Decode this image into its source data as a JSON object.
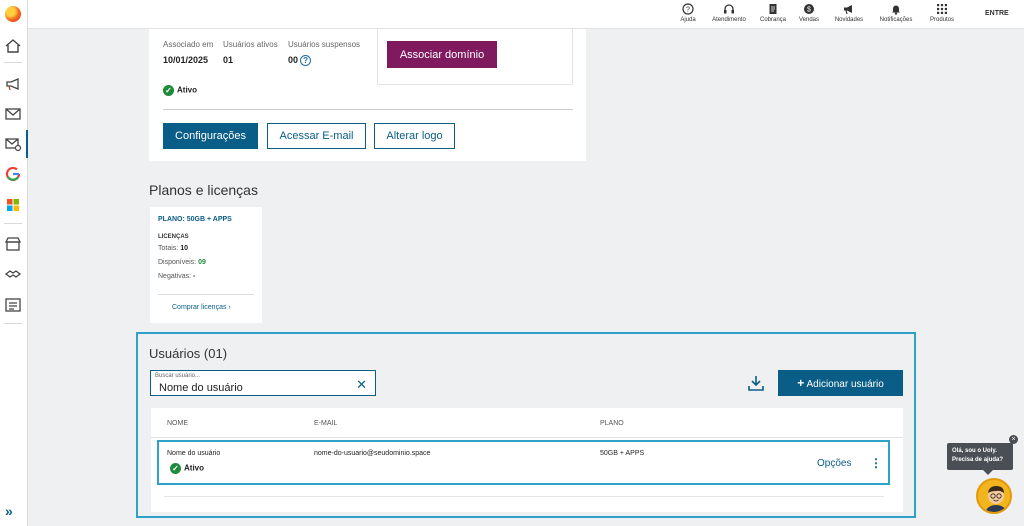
{
  "rail": {
    "icons": [
      "home-icon",
      "megaphone-icon",
      "mail-icon",
      "mail-settings-icon",
      "google-icon",
      "windows-icon",
      "store-icon",
      "handshake-icon",
      "list-icon"
    ],
    "expand": "»"
  },
  "topbar": {
    "items": [
      {
        "icon": "help-icon",
        "label": "Ajuda"
      },
      {
        "icon": "headset-icon",
        "label": "Atendimento"
      },
      {
        "icon": "invoice-icon",
        "label": "Cobrança"
      },
      {
        "icon": "sales-icon",
        "label": "Vendas"
      },
      {
        "icon": "megaphone-icon",
        "label": "Novidades"
      },
      {
        "icon": "bell-icon",
        "label": "Notificações"
      },
      {
        "icon": "grid-icon",
        "label": "Produtos"
      }
    ],
    "login": "ENTRE"
  },
  "domain": {
    "associated_label": "Associado em",
    "associated_value": "10/01/2025",
    "active_users_label": "Usuários ativos",
    "active_users_value": "01",
    "suspended_label": "Usuários suspensos",
    "suspended_value": "00",
    "help": "?",
    "associate_button": "Associar domínio",
    "status": "Ativo",
    "configure_button": "Configurações",
    "access_email_button": "Acessar E-mail",
    "change_logo_button": "Alterar logo"
  },
  "plans": {
    "title": "Planos e licenças",
    "card": {
      "plan_name": "PLANO: 50GB + APPS",
      "licenses_label": "LICENÇAS",
      "total_label": "Totais:",
      "total_value": "10",
      "available_label": "Disponíveis:",
      "available_value": "09",
      "denied_label": "Negativas:",
      "denied_value": "-",
      "buy_link": "Comprar licenças ›"
    }
  },
  "users": {
    "title": "Usuários (01)",
    "search_label": "Buscar usuário...",
    "search_value": "Nome do usuário",
    "add_button": "Adicionar usuário",
    "columns": {
      "name": "NOME",
      "email": "E-MAIL",
      "plan": "PLANO"
    },
    "rows": [
      {
        "name": "Nome do usuário",
        "email": "nome-do-usuario@seudominio.space",
        "plan": "50GB + APPS",
        "status": "Ativo",
        "options": "Opções"
      }
    ]
  },
  "chat": {
    "line1": "Olá, sou o Uoly.",
    "line2": "Precisa de ajuda?",
    "close": "×"
  },
  "colors": {
    "primary": "#0a5d86",
    "accent": "#7f1a5e",
    "success": "#1e8a3c",
    "highlight": "#2ea3c7"
  }
}
